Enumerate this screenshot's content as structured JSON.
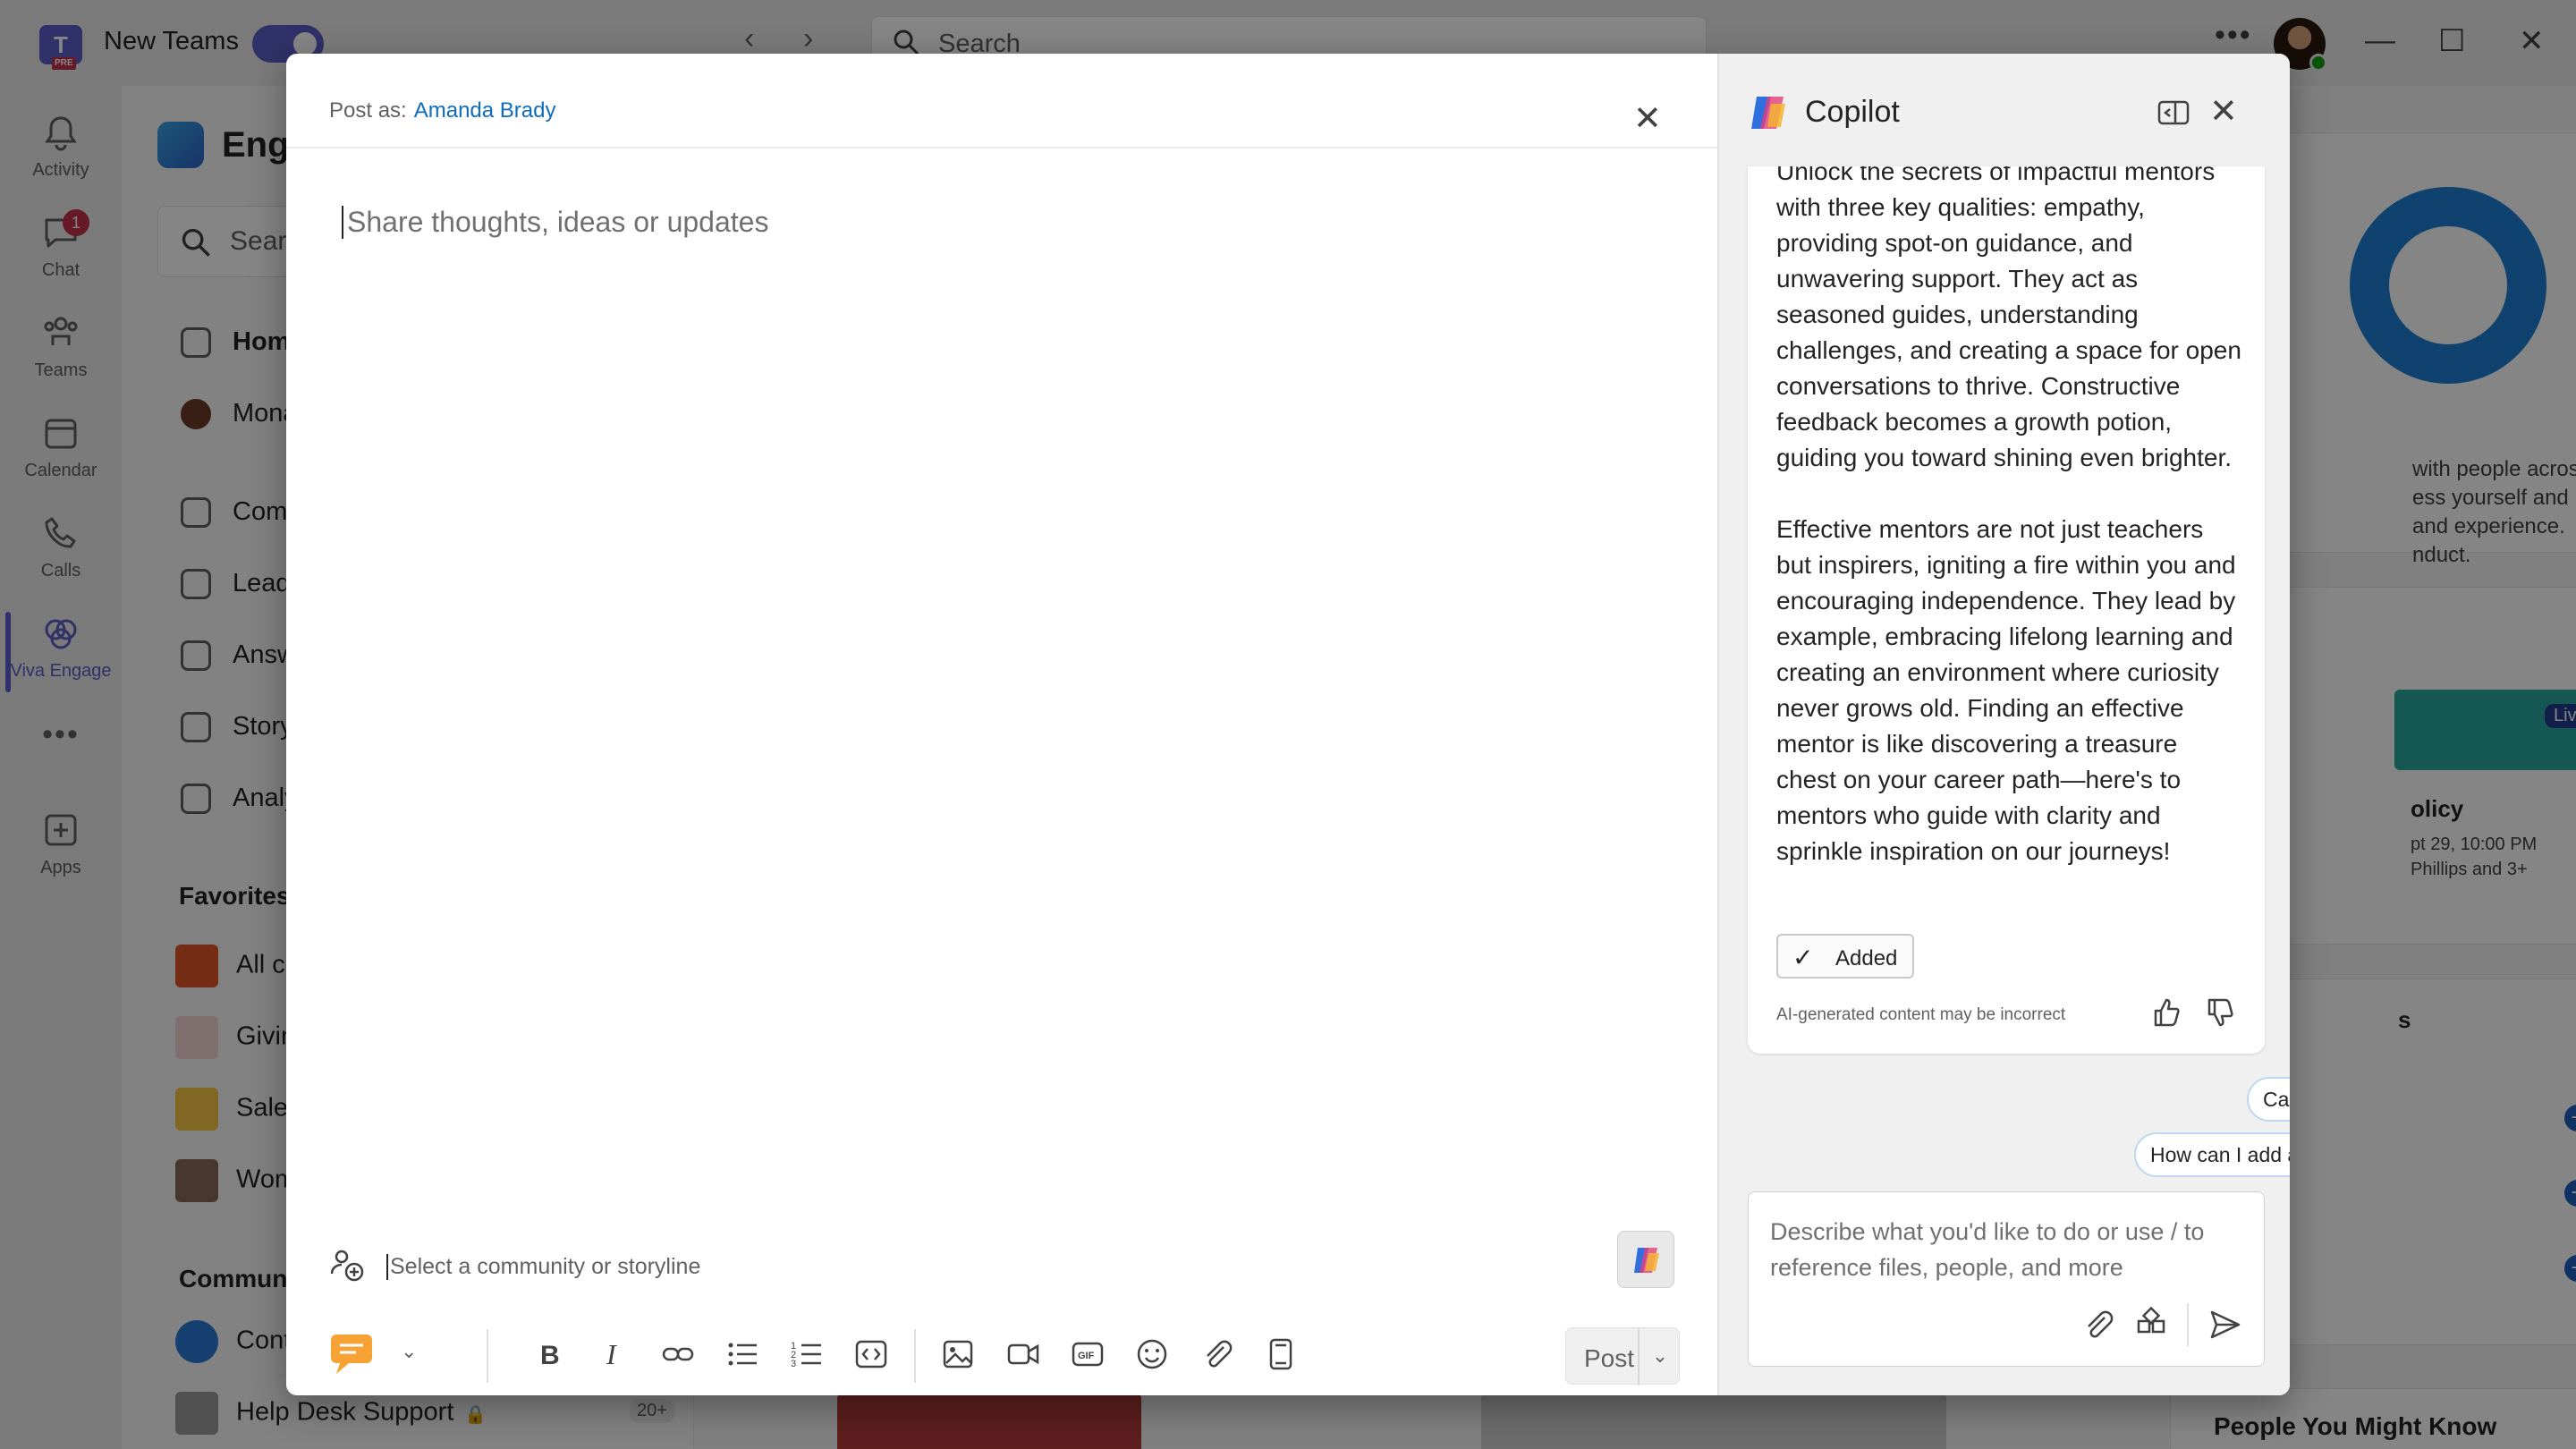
{
  "titlebar": {
    "app_name": "New Teams",
    "search_placeholder": "Search",
    "more": "•••",
    "back": "‹",
    "forward": "›"
  },
  "rail": {
    "items": [
      {
        "label": "Activity"
      },
      {
        "label": "Chat",
        "badge": "1"
      },
      {
        "label": "Teams"
      },
      {
        "label": "Calendar"
      },
      {
        "label": "Calls"
      },
      {
        "label": "Viva Engage"
      },
      {
        "label": "Apps"
      }
    ],
    "more": "•••"
  },
  "engage": {
    "title": "Engage",
    "search_placeholder": "Search",
    "nav": [
      "Home",
      "Mona",
      "Communities",
      "Leadership",
      "Answers",
      "Storyline",
      "Analytics"
    ],
    "favorites_heading": "Favorites",
    "favorites": [
      "All company",
      "Giving",
      "Sales",
      "Women"
    ],
    "communities_heading": "Communities",
    "communities": [
      "Contoso",
      "Help Desk Support"
    ],
    "help_desk_count": "20+",
    "right_panel": {
      "snippet_lines": [
        "with people across",
        "ess yourself and",
        "and experience.",
        "nduct."
      ],
      "live_badge": "Live",
      "event_title": "olicy",
      "event_time": "pt 29, 10:00 PM",
      "event_people": "Phillips and 3+",
      "people_heading": "People You Might Know",
      "section_char": "s"
    }
  },
  "compose": {
    "post_as_label": "Post as:",
    "post_as_name": "Amanda Brady",
    "placeholder": "Share thoughts, ideas or updates",
    "community_placeholder": "Select a community or storyline",
    "post_label": "Post"
  },
  "copilot": {
    "title": "Copilot",
    "truncated_line": "Unlock the secrets of impactful mentors",
    "paragraphs": [
      "with three key qualities: empathy, providing spot-on guidance, and unwavering support. They act as seasoned guides, understanding challenges, and creating a space for open conversations to thrive. Constructive feedback becomes a growth potion, guiding you toward shining even brighter.",
      "Effective mentors are not just teachers but inspirers, igniting a fire within you and encouraging independence. They lead by example, embracing lifelong learning and creating an environment where curiosity never grows old. Finding an effective mentor is like discovering a treasure chest on your career path—here's to mentors who guide with clarity and sprinkle inspiration on our journeys!"
    ],
    "added_label": "Added",
    "ai_note": "AI-generated content may be incorrect",
    "suggestions": [
      "Can you add a call to action?",
      "How can I add a personal example?"
    ],
    "input_placeholder": "Describe what you'd like to do or use / to reference files, people, and more"
  },
  "colors": {
    "accent": "#5b5fc7",
    "link": "#0f6cbd",
    "badge": "#c4314b",
    "announcement": "#f7a234"
  }
}
